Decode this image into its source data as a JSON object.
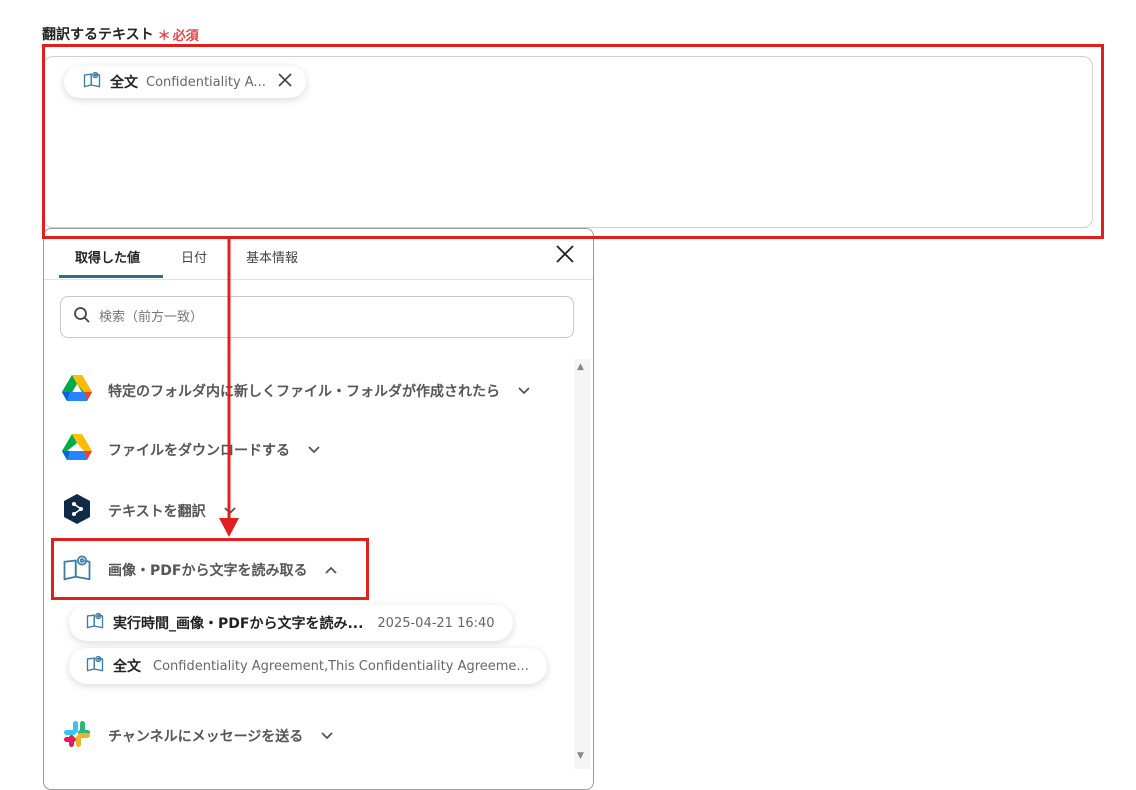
{
  "field": {
    "label": "翻訳するテキスト",
    "required_mark": "＊",
    "required_text": "必須"
  },
  "input_chip": {
    "title": "全文",
    "value": "Confidentiality A...",
    "close_icon": "close-icon"
  },
  "panel": {
    "tabs": [
      {
        "label": "取得した値"
      },
      {
        "label": "日付"
      },
      {
        "label": "基本情報"
      }
    ],
    "search_placeholder": "検索（前方一致）",
    "sections": [
      {
        "label": "特定のフォルダ内に新しくファイル・フォルダが作成されたら",
        "icon": "google-drive-icon",
        "expanded": false
      },
      {
        "label": "ファイルをダウンロードする",
        "icon": "google-drive-icon",
        "expanded": false
      },
      {
        "label": "テキストを翻訳",
        "icon": "deepl-icon",
        "expanded": false
      },
      {
        "label": "画像・PDFから文字を読み取る",
        "icon": "ocr-book-icon",
        "expanded": true,
        "items": [
          {
            "title": "実行時間_画像・PDFから文字を読み...",
            "value": "2025-04-21 16:40"
          },
          {
            "title": "全文",
            "value": "Confidentiality Agreement,This Confidentiality Agreeme..."
          }
        ]
      },
      {
        "label": "チャンネルにメッセージを送る",
        "icon": "slack-icon",
        "expanded": false
      }
    ]
  },
  "colors": {
    "highlight": "#e0201f",
    "required": "#e0474c",
    "tab_underline": "#2f6f8d"
  }
}
